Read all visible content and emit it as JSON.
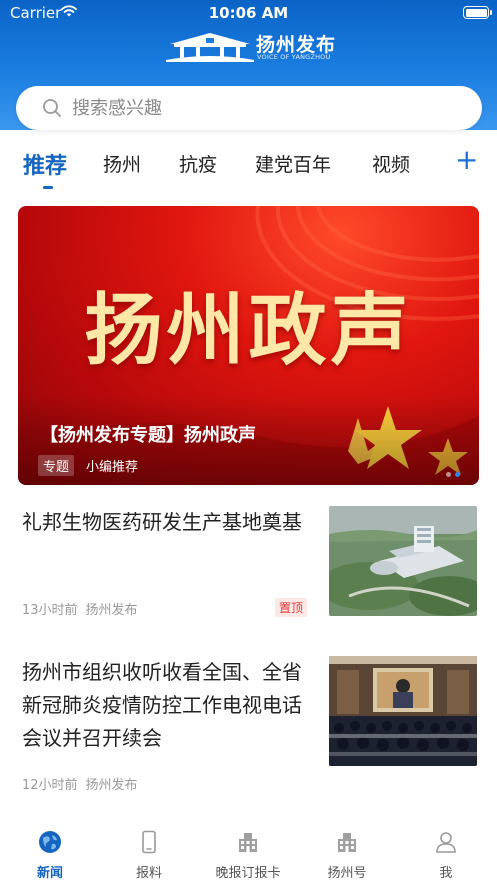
{
  "status_bar": {
    "carrier": "Carrier",
    "time": "10:06 AM"
  },
  "header": {
    "title": "扬州发布",
    "subtitle": "VOICE OF YANGZHOU"
  },
  "search": {
    "placeholder": "搜索感兴趣"
  },
  "tabs": [
    {
      "label": "推荐",
      "active": true
    },
    {
      "label": "扬州"
    },
    {
      "label": "抗疫"
    },
    {
      "label": "建党百年"
    },
    {
      "label": "视频"
    }
  ],
  "tab_add_label": "+",
  "banner": {
    "image_text": "扬州政声",
    "title": "【扬州发布专题】扬州政声",
    "tag": "专题",
    "source": "小编推荐",
    "slide_count": 2,
    "active_slide": 2
  },
  "articles": [
    {
      "title": "礼邦生物医药研发生产基地奠基",
      "time": "13小时前",
      "source": "扬州发布",
      "badge": "置顶"
    },
    {
      "title": "扬州市组织收听收看全国、全省新冠肺炎疫情防控工作电视电话会议并召开续会",
      "time": "12小时前",
      "source": "扬州发布"
    }
  ],
  "bottom_nav": [
    {
      "label": "新闻",
      "icon": "globe-icon",
      "active": true
    },
    {
      "label": "报料",
      "icon": "phone-icon"
    },
    {
      "label": "晚报订报卡",
      "icon": "building-icon"
    },
    {
      "label": "扬州号",
      "icon": "building-icon"
    },
    {
      "label": "我",
      "icon": "person-icon"
    }
  ],
  "colors": {
    "brand_blue": "#1565c0",
    "header_blue": "#1a7ee0",
    "banner_red": "#e0160f",
    "banner_gold": "#ffe7a8",
    "pin_red": "#e53935"
  }
}
